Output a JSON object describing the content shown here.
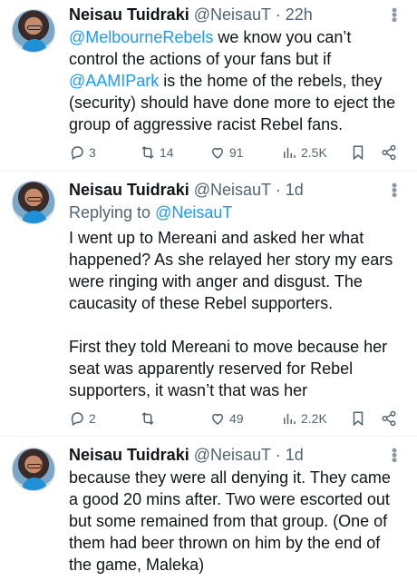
{
  "tweets": [
    {
      "name": "Neisau Tuidraki",
      "handle": "@NeisauT",
      "sep": "·",
      "time": "22h",
      "lines": [
        [
          {
            "t": "@MelbourneRebels",
            "m": true
          },
          {
            "t": " we know you can’t",
            "m": false
          }
        ],
        [
          {
            "t": "control the actions of your fans but if",
            "m": false
          }
        ],
        [
          {
            "t": "@AAMIPark",
            "m": true
          },
          {
            "t": " is the home of the rebels, they",
            "m": false
          }
        ],
        [
          {
            "t": "(security) should have done more to eject the",
            "m": false
          }
        ],
        [
          {
            "t": "group of aggressive racist Rebel fans.",
            "m": false
          }
        ]
      ],
      "actions": {
        "replies": "3",
        "retweets": "14",
        "likes": "91",
        "views": "2.5K"
      }
    },
    {
      "name": "Neisau Tuidraki",
      "handle": "@NeisauT",
      "sep": "·",
      "time": "1d",
      "reply_prefix": "Replying to ",
      "reply_to": "@NeisauT",
      "lines": [
        [
          {
            "t": "I went up to Mereani and asked her what",
            "m": false
          }
        ],
        [
          {
            "t": "happened? As she relayed her story my ears",
            "m": false
          }
        ],
        [
          {
            "t": "were ringing with anger and disgust. The",
            "m": false
          }
        ],
        [
          {
            "t": "caucasity of these Rebel supporters.",
            "m": false
          }
        ],
        [],
        [
          {
            "t": "First they told Mereani to move because her",
            "m": false
          }
        ],
        [
          {
            "t": "seat was apparently reserved for Rebel",
            "m": false
          }
        ],
        [
          {
            "t": "supporters, it wasn’t that was her",
            "m": false
          }
        ]
      ],
      "actions": {
        "replies": "2",
        "retweets": "",
        "likes": "49",
        "views": "2.2K"
      }
    },
    {
      "name": "Neisau Tuidraki",
      "handle": "@NeisauT",
      "sep": "·",
      "time": "1d",
      "lines": [
        [
          {
            "t": "because they were all denying it. They came",
            "m": false
          }
        ],
        [
          {
            "t": "a good 20 mins after. Two were escorted out",
            "m": false
          }
        ],
        [
          {
            "t": "but some remained from that group. (One of",
            "m": false
          }
        ],
        [
          {
            "t": "them had beer thrown on him by the end of",
            "m": false
          }
        ],
        [
          {
            "t": "the game, Maleka)",
            "m": false
          }
        ]
      ]
    }
  ],
  "colors": {
    "link": "#1d9bf0",
    "muted": "#536471",
    "text": "#0f1419"
  },
  "icons": {
    "more": "more-dots-icon",
    "reply": "reply-icon",
    "retweet": "retweet-icon",
    "like": "heart-icon",
    "views": "views-chart-icon",
    "bookmark": "bookmark-icon",
    "share": "share-icon"
  }
}
